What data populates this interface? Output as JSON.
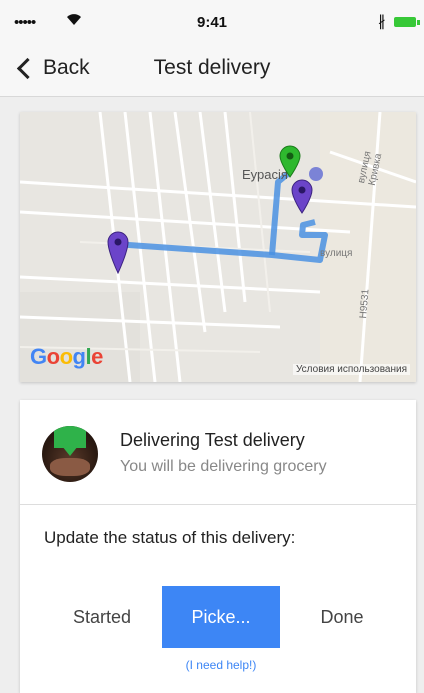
{
  "status_bar": {
    "signal": "•••••",
    "time": "9:41",
    "bluetooth": "∦"
  },
  "nav": {
    "back_label": "Back",
    "title": "Test delivery"
  },
  "map": {
    "place_label": "Еурасія",
    "street_labels": [
      "вулиця Кривка",
      "Н9531",
      "вулиця"
    ],
    "google": [
      "G",
      "o",
      "o",
      "g",
      "l",
      "e"
    ],
    "terms": "Условия использования",
    "marker_colors": {
      "start": "#2eb82e",
      "stop": "#6b44c9"
    },
    "route_color": "#4a90e2"
  },
  "delivery": {
    "title": "Delivering Test delivery",
    "subtitle": "You will be delivering grocery",
    "update_label": "Update the status of this delivery:",
    "statuses": {
      "started": "Started",
      "picked": "Picke...",
      "done": "Done"
    },
    "help": "(I need help!)",
    "accent": "#3d86f5"
  }
}
